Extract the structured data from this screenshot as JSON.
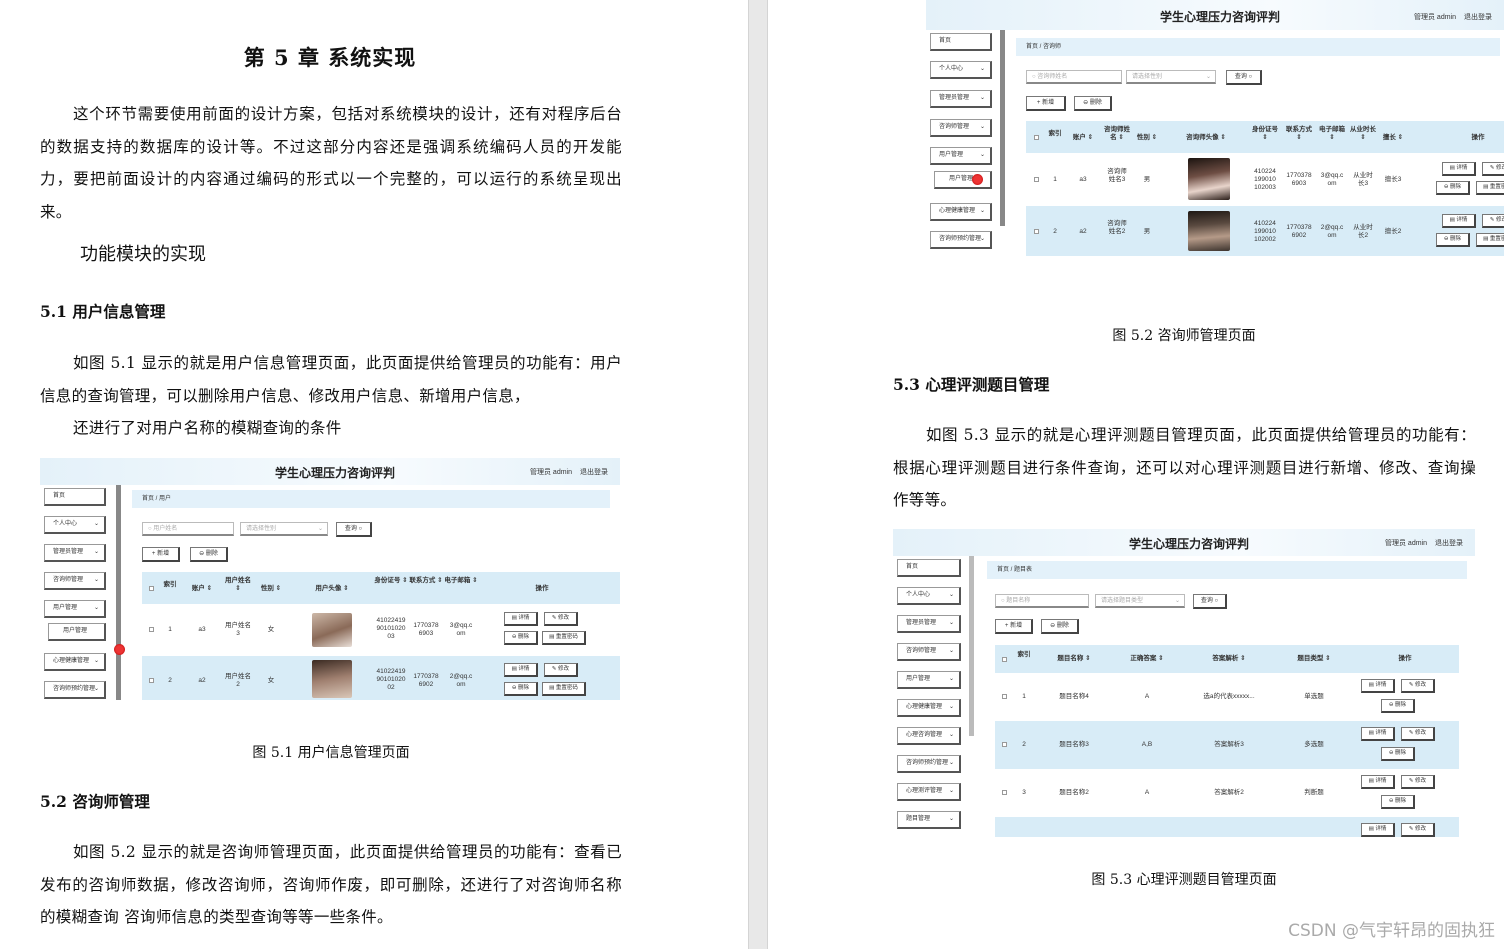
{
  "left_page": {
    "chapter_title": "第 5 章  系统实现",
    "intro": "这个环节需要使用前面的设计方案，包括对系统模块的设计，还有对程序后台的数据支持的数据库的设计等。不过这部分内容还是强调系统编码人员的开发能力，要把前面设计的内容通过编码的形式以一个完整的，可以运行的系统呈现出来。",
    "module_heading": "功能模块的实现",
    "sec51_title": "5.1 用户信息管理",
    "sec51_text": "如图 5.1 显示的就是用户信息管理页面，此页面提供给管理员的功能有：用户信息的查询管理，可以删除用户信息、修改用户信息、新增用户信息，",
    "sec51_text2": "还进行了对用户名称的模糊查询的条件",
    "fig51_caption": "图 5.1  用户信息管理页面",
    "sec52_title": "5.2  咨询师管理",
    "sec52_text": "如图 5.2 显示的就是咨询师管理页面，此页面提供给管理员的功能有：查看已发布的咨询师数据，修改咨询师，咨询师作废，即可删除，还进行了对咨询师名称的模糊查询  咨询师信息的类型查询等等一些条件。"
  },
  "right_page": {
    "fig52_caption": "图 5.2  咨询师管理页面",
    "sec53_title": "5.3 心理评测题目管理",
    "sec53_text": "如图 5.3 显示的就是心理评测题目管理页面，此页面提供给管理员的功能有：根据心理评测题目进行条件查询，还可以对心理评测题目进行新增、修改、查询操作等等。",
    "fig53_caption": "图 5.3  心理评测题目管理页面"
  },
  "app": {
    "title": "学生心理压力咨询评判",
    "admin": "管理员 admin",
    "logout": "退出登录",
    "add": "+ 新增",
    "delete": "⊖ 删除",
    "search": "查询 ○",
    "detail": "▤ 详情",
    "edit": "✎ 修改",
    "del": "⊖ 删除",
    "reset_pwd": "▤ 重置密码",
    "ops": "操作"
  },
  "shot1": {
    "crumb": "首页  /  用户",
    "search_placeholder": "○ 用户姓名",
    "select_placeholder": "请选择性别",
    "sidebar": [
      "首页",
      "个人中心",
      "管理员管理",
      "咨询师管理",
      "用户管理",
      "用户管理",
      "心理健康管理",
      "咨询师预约管理"
    ],
    "headers": [
      "索引",
      "账户 ⇕",
      "用户姓名 ⇕",
      "性别 ⇕",
      "用户头像 ⇕",
      "身份证号 ⇕",
      "联系方式 ⇕",
      "电子邮箱 ⇕"
    ],
    "rows": [
      {
        "idx": "1",
        "account": "a3",
        "name": "用户姓名3",
        "gender": "女",
        "id": "410224199010102003",
        "phone": "17703786903",
        "email": "3@qq.com"
      },
      {
        "idx": "2",
        "account": "a2",
        "name": "用户姓名2",
        "gender": "女",
        "id": "410224199010102002",
        "phone": "17703786902",
        "email": "2@qq.com"
      }
    ]
  },
  "shot2": {
    "crumb": "首页  /  咨询师",
    "search_placeholder": "○ 咨询师姓名",
    "select_placeholder": "请选择性别",
    "sidebar": [
      "首页",
      "个人中心",
      "管理员管理",
      "咨询师管理",
      "用户管理",
      "用户管理",
      "心理健康管理",
      "咨询师预约管理"
    ],
    "headers": [
      "索引",
      "账户 ⇕",
      "咨询师姓名 ⇕",
      "性别 ⇕",
      "咨询师头像 ⇕",
      "身份证号 ⇕",
      "联系方式 ⇕",
      "电子邮箱 ⇕",
      "从业时长 ⇕",
      "擅长 ⇕"
    ],
    "rows": [
      {
        "idx": "1",
        "account": "a3",
        "name": "咨询师姓名3",
        "gender": "男",
        "id": "410224199010102003",
        "phone": "17703786903",
        "email": "3@qq.com",
        "years": "从业时长3",
        "skill": "擅长3"
      },
      {
        "idx": "2",
        "account": "a2",
        "name": "咨询师姓名2",
        "gender": "男",
        "id": "410224199010102002",
        "phone": "17703786902",
        "email": "2@qq.com",
        "years": "从业时长2",
        "skill": "擅长2"
      }
    ]
  },
  "shot3": {
    "crumb": "首页  /  题目表",
    "search_placeholder": "○ 题目名称",
    "select_placeholder": "请选择题目类型",
    "sidebar": [
      "首页",
      "个人中心",
      "管理员管理",
      "咨询师管理",
      "用户管理",
      "心理健康管理",
      "心理咨询管理",
      "咨询师预约管理",
      "心理测评管理",
      "题目管理"
    ],
    "headers": [
      "索引",
      "题目名称 ⇕",
      "正确答案 ⇕",
      "答案解析 ⇕",
      "题目类型 ⇕"
    ],
    "rows": [
      {
        "idx": "1",
        "name": "题目名称4",
        "answer": "A",
        "analysis": "选a的代表xxxxx...",
        "type": "单选题"
      },
      {
        "idx": "2",
        "name": "题目名称3",
        "answer": "A,B",
        "analysis": "答案解析3",
        "type": "多选题"
      },
      {
        "idx": "3",
        "name": "题目名称2",
        "answer": "A",
        "analysis": "答案解析2",
        "type": "判断题"
      }
    ]
  },
  "watermark": "CSDN @气宇轩昂的固执狂"
}
